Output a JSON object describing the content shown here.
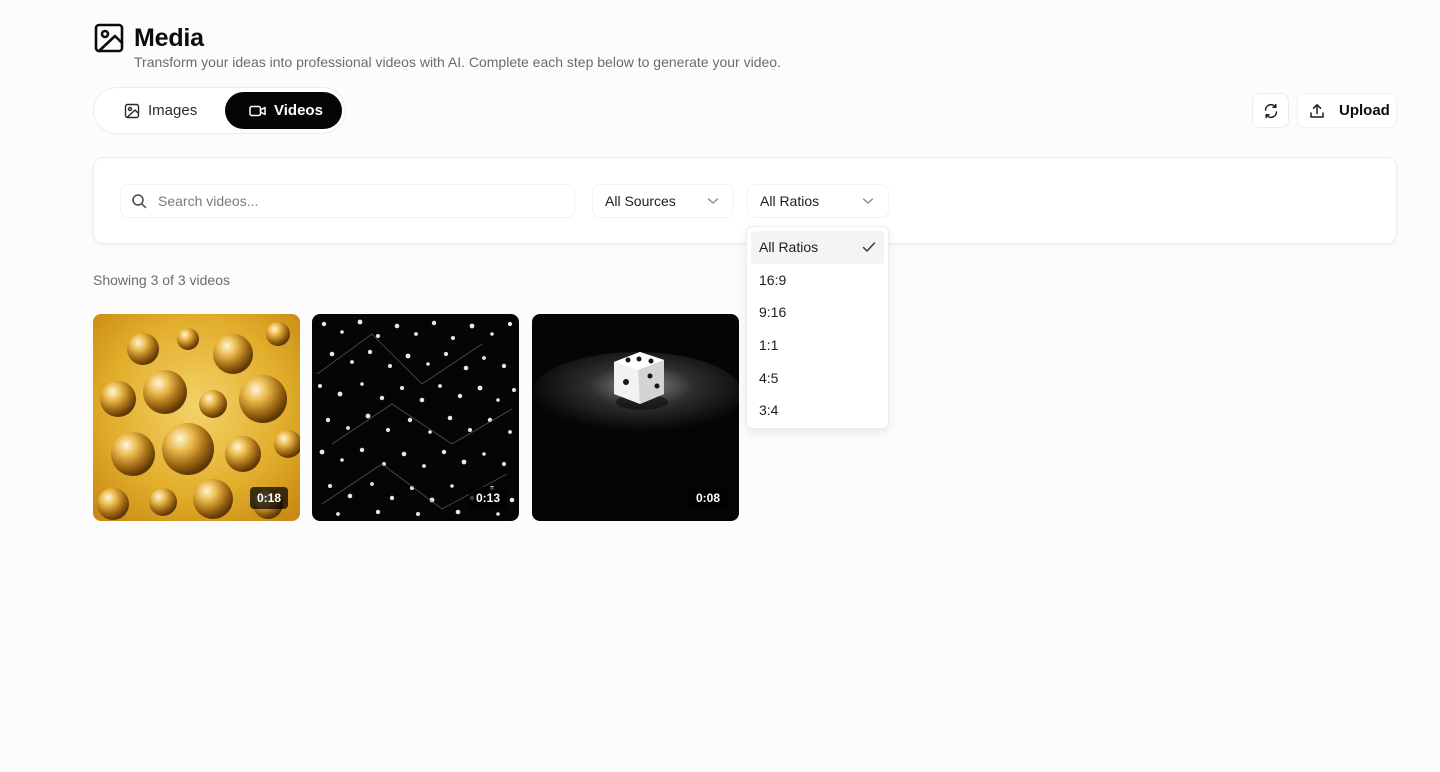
{
  "header": {
    "title": "Media",
    "subtitle": "Transform your ideas into professional videos with AI. Complete each step below to generate your video."
  },
  "tabs": [
    {
      "label": "Images",
      "icon": "image-icon",
      "active": false
    },
    {
      "label": "Videos",
      "icon": "video-icon",
      "active": true
    }
  ],
  "actions": {
    "refresh_icon": "refresh-icon",
    "upload_label": "Upload"
  },
  "filters": {
    "search_placeholder": "Search videos...",
    "sources_value": "All Sources",
    "ratios_value": "All Ratios"
  },
  "results": {
    "showing_text": "Showing 3 of 3 videos"
  },
  "videos": [
    {
      "duration": "0:18"
    },
    {
      "duration": "0:13"
    },
    {
      "duration": "0:08"
    }
  ],
  "ratio_menu": {
    "options": [
      "All Ratios",
      "16:9",
      "9:16",
      "1:1",
      "4:5",
      "3:4"
    ],
    "selected": "All Ratios"
  },
  "colors": {
    "accent": "#050505",
    "background": "#fdfcfd",
    "muted_text": "#6b6b70"
  }
}
